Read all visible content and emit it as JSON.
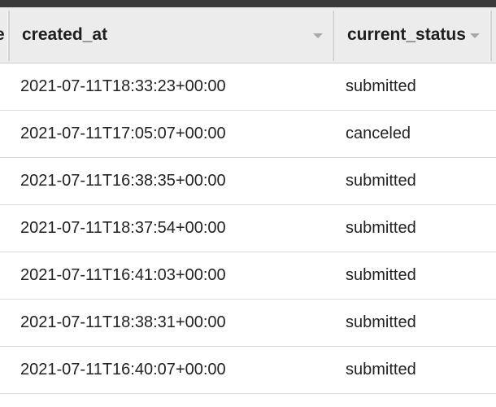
{
  "table": {
    "columns": [
      {
        "label": "e"
      },
      {
        "label": "created_at"
      },
      {
        "label": "current_status"
      }
    ],
    "rows": [
      {
        "created_at": "2021-07-11T18:33:23+00:00",
        "current_status": "submitted"
      },
      {
        "created_at": "2021-07-11T17:05:07+00:00",
        "current_status": "canceled"
      },
      {
        "created_at": "2021-07-11T16:38:35+00:00",
        "current_status": "submitted"
      },
      {
        "created_at": "2021-07-11T18:37:54+00:00",
        "current_status": "submitted"
      },
      {
        "created_at": "2021-07-11T16:41:03+00:00",
        "current_status": "submitted"
      },
      {
        "created_at": "2021-07-11T18:38:31+00:00",
        "current_status": "submitted"
      },
      {
        "created_at": "2021-07-11T16:40:07+00:00",
        "current_status": "submitted"
      }
    ]
  },
  "icons": {
    "sort": "sort-caret-down-icon"
  },
  "colors": {
    "header_bg": "#ececec",
    "topbar": "#3a3a3a",
    "row_border": "#dcdcdc"
  }
}
